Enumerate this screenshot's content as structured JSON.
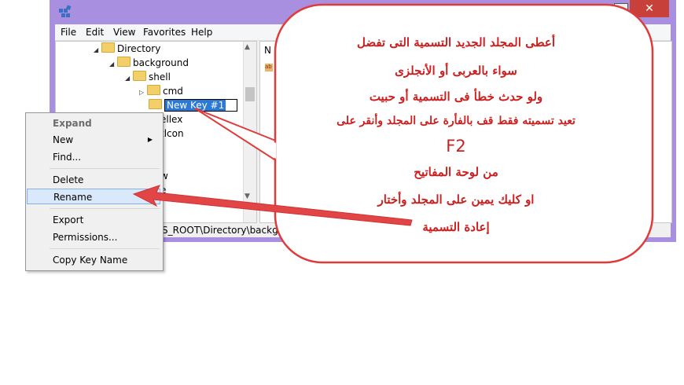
{
  "menubar": [
    "File",
    "Edit",
    "View",
    "Favorites",
    "Help"
  ],
  "tree": {
    "directory": "Directory",
    "background": "background",
    "shell": "shell",
    "cmd": "cmd",
    "new_key": "New Key #1",
    "partial_1": "ellex",
    "partial_2": "tlcon",
    "partial_3": "w",
    "partial_4": "e"
  },
  "values_header": "N",
  "value_icon": "ab",
  "statusbar": "S_ROOT\\Directory\\backgrou",
  "close_label": "✕",
  "context_menu": {
    "expand": "Expand",
    "new": "New",
    "find": "Find...",
    "delete": "Delete",
    "rename": "Rename",
    "export": "Export",
    "permissions": "Permissions...",
    "copy_key_name": "Copy Key Name"
  },
  "callout": {
    "line1": "أعطى المجلد الجديد التسمية التى تفضل",
    "line2": "سواء بالعربى أو الأنجلزى",
    "line3": "ولو حدث خطأ فى التسمية أو حبيت",
    "line4": "تعيد تسميته فقط قف بالفأرة على المجلد وأنقر على",
    "line5": "F2",
    "line6": "من لوحة المفاتيح",
    "line7": "او كليك يمين على المجلد وأختار",
    "line8": "إعادة التسمية"
  },
  "colors": {
    "window_frame": "#a98fe0",
    "callout_text": "#cc1f1f",
    "callout_border": "#e03b3b",
    "arrow": "#e24545",
    "selection": "#2b79d6"
  }
}
